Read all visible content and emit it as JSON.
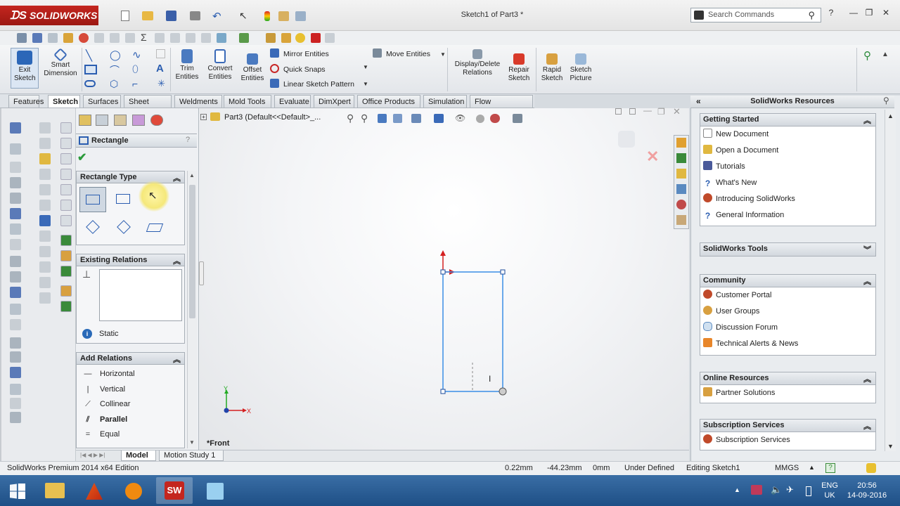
{
  "app": {
    "logo_text": "SOLIDWORKS",
    "window_title": "Sketch1 of Part3 *"
  },
  "search": {
    "placeholder": "Search Commands"
  },
  "ribbon": {
    "exit_sketch": "Exit Sketch",
    "smart_dimension": "Smart Dimension",
    "trim_entities": "Trim Entities",
    "convert_entities": "Convert Entities",
    "offset_entities": "Offset Entities",
    "mirror_entities": "Mirror Entities",
    "quick_snaps": "Quick Snaps",
    "linear_sketch_pattern": "Linear Sketch Pattern",
    "move_entities": "Move Entities",
    "display_delete_relations": "Display/Delete Relations",
    "repair_sketch": "Repair Sketch",
    "rapid_sketch": "Rapid Sketch",
    "sketch_picture": "Sketch Picture"
  },
  "tabs": [
    "Features",
    "Sketch",
    "Surfaces",
    "Sheet Metal",
    "Weldments",
    "Mold Tools",
    "Evaluate",
    "DimXpert",
    "Office Products",
    "Simulation",
    "Flow Simulation"
  ],
  "active_tab": "Sketch",
  "property_manager": {
    "title": "Rectangle",
    "rectangle_type_label": "Rectangle Type",
    "existing_relations_label": "Existing Relations",
    "status_text": "Static",
    "add_relations_label": "Add Relations",
    "relations": [
      "Horizontal",
      "Vertical",
      "Collinear",
      "Parallel",
      "Equal"
    ]
  },
  "graphics": {
    "tree_breadcrumb": "Part3  (Default<<Default>_...",
    "view_label": "*Front",
    "axis_x": "X",
    "axis_y": "Y",
    "cursor_glyph": "I"
  },
  "task_pane": {
    "title": "SolidWorks Resources",
    "sections": [
      {
        "title": "Getting Started",
        "items": [
          "New Document",
          "Open a Document",
          "Tutorials",
          "What's New",
          "Introducing SolidWorks",
          "General Information"
        ]
      },
      {
        "title": "SolidWorks Tools",
        "items": []
      },
      {
        "title": "Community",
        "items": [
          "Customer Portal",
          "User Groups",
          "Discussion Forum",
          "Technical Alerts & News"
        ]
      },
      {
        "title": "Online Resources",
        "items": [
          "Partner Solutions"
        ]
      },
      {
        "title": "Subscription Services",
        "items": [
          "Subscription Services"
        ]
      }
    ]
  },
  "bottom_tabs": [
    "Model",
    "Motion Study 1"
  ],
  "status": {
    "edition": "SolidWorks Premium 2014 x64 Edition",
    "x": "0.22mm",
    "y": "-44.23mm",
    "z": "0mm",
    "state": "Under Defined",
    "editing": "Editing Sketch1",
    "units": "MMGS"
  },
  "taskbar": {
    "language": "ENG",
    "region": "UK",
    "time": "20:56",
    "date": "14-09-2016"
  },
  "colors": {
    "accent_red": "#c4261f",
    "sketch_blue": "#3a8ee6",
    "taskbar": "#2b5f96"
  }
}
